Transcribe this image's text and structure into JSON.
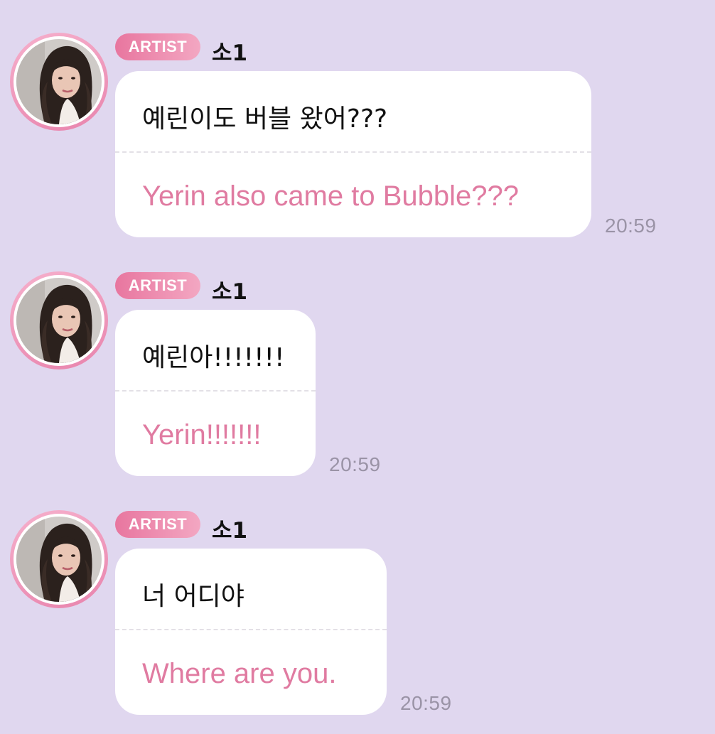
{
  "messages": [
    {
      "badge": "ARTIST",
      "sender": "소1",
      "text_ko": "예린이도 버블 왔어???",
      "text_en": "Yerin also came to Bubble???",
      "time": "20:59"
    },
    {
      "badge": "ARTIST",
      "sender": "소1",
      "text_ko": "예린아!!!!!!!",
      "text_en": "Yerin!!!!!!!",
      "time": "20:59"
    },
    {
      "badge": "ARTIST",
      "sender": "소1",
      "text_ko": "너 어디야",
      "text_en": "Where are you.",
      "time": "20:59"
    }
  ],
  "colors": {
    "background": "#e0d7ef",
    "badge_accent": "#e8769f",
    "translation_text": "#e07ba1",
    "timestamp": "#9a93a6"
  },
  "icons": {
    "avatar": "artist-profile-photo"
  }
}
